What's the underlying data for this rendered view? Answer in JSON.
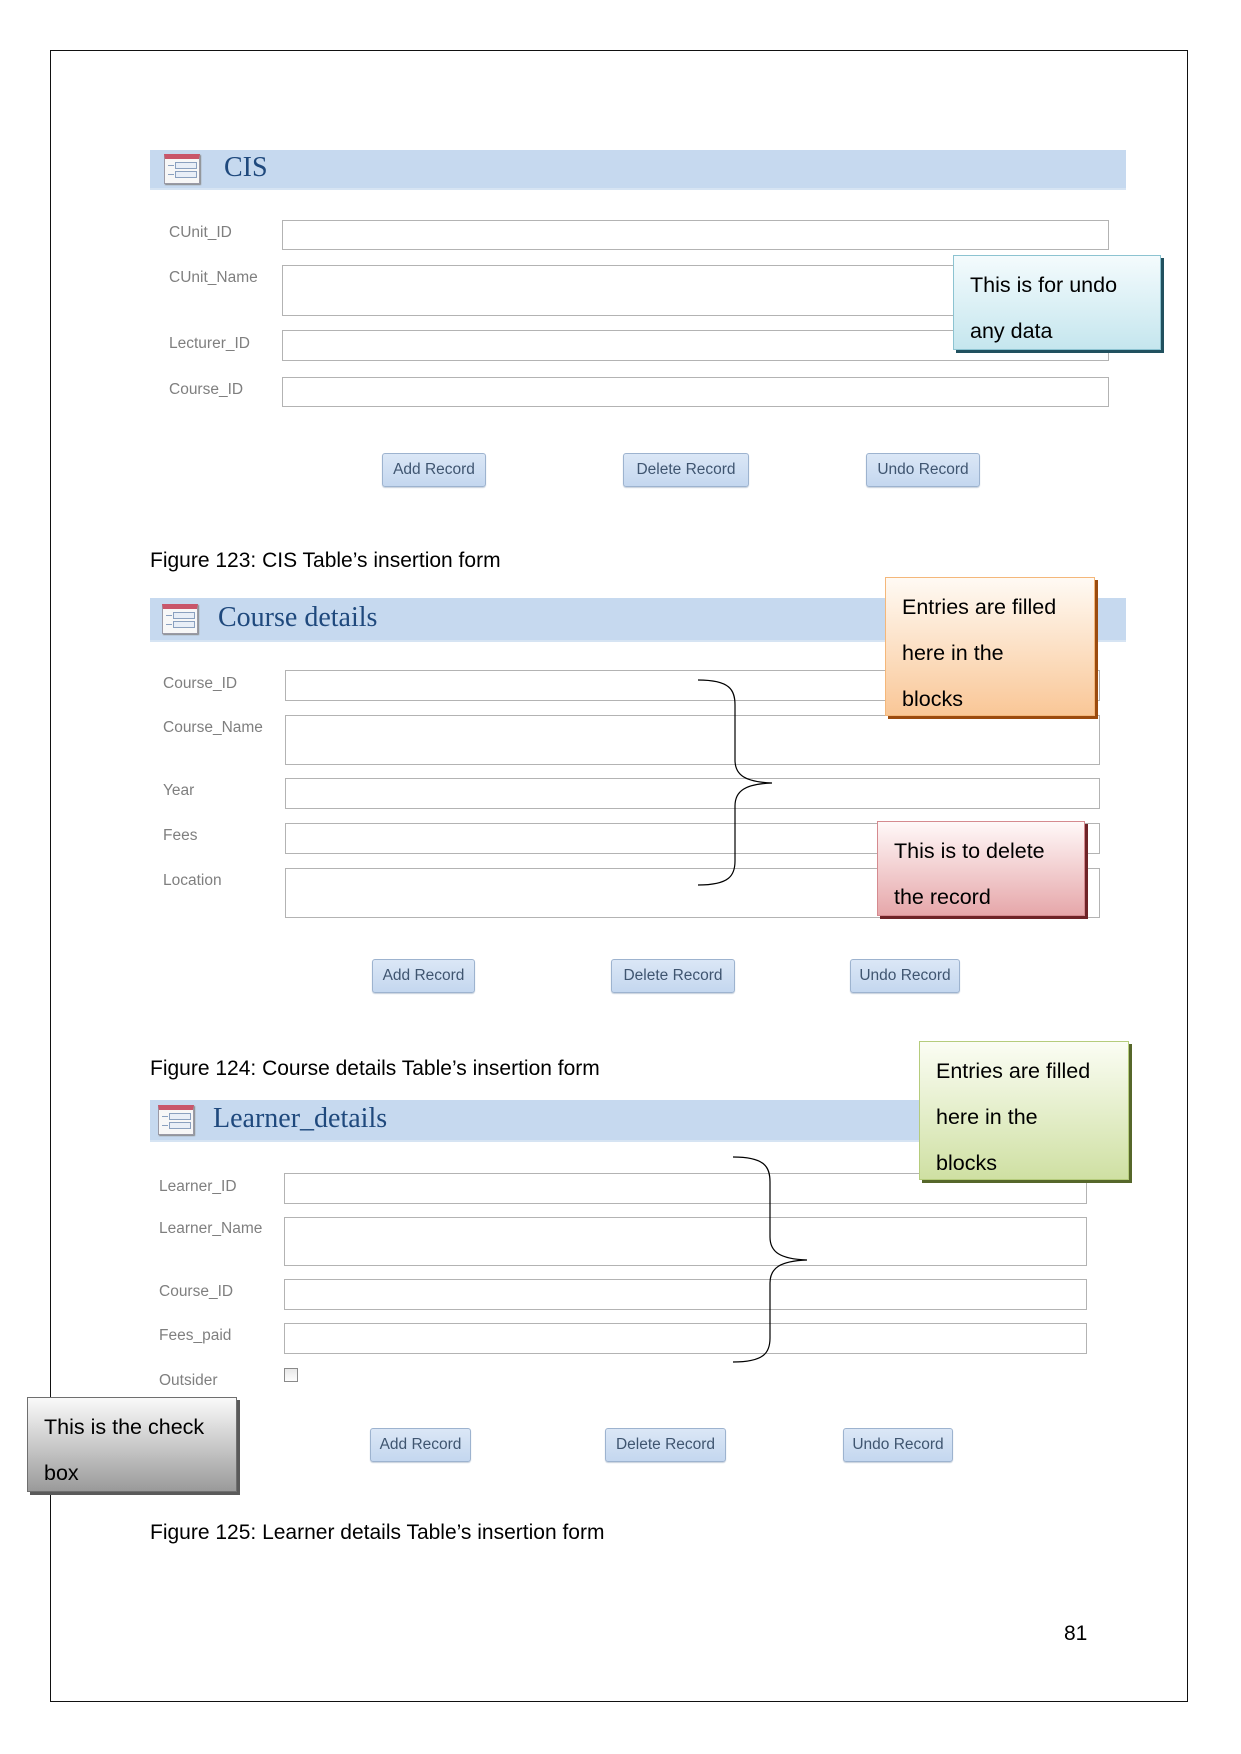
{
  "forms": [
    {
      "title": "CIS",
      "fields": [
        {
          "label": "CUnit_ID",
          "value": ""
        },
        {
          "label": "CUnit_Name",
          "value": ""
        },
        {
          "label": "Lecturer_ID",
          "value": ""
        },
        {
          "label": "Course_ID",
          "value": ""
        }
      ],
      "buttons": [
        "Add Record",
        "Delete Record",
        "Undo Record"
      ],
      "caption": "Figure 123: CIS Table’s insertion form"
    },
    {
      "title": "Course details",
      "fields": [
        {
          "label": "Course_ID",
          "value": ""
        },
        {
          "label": "Course_Name",
          "value": ""
        },
        {
          "label": "Year",
          "value": ""
        },
        {
          "label": "Fees",
          "value": ""
        },
        {
          "label": "Location",
          "value": ""
        }
      ],
      "buttons": [
        "Add Record",
        "Delete Record",
        "Undo Record"
      ],
      "caption": "Figure 124: Course details Table’s insertion form"
    },
    {
      "title": "Learner_details",
      "fields": [
        {
          "label": "Learner_ID",
          "value": ""
        },
        {
          "label": "Learner_Name",
          "value": ""
        },
        {
          "label": "Course_ID",
          "value": ""
        },
        {
          "label": "Fees_paid",
          "value": ""
        },
        {
          "label": "Outsider",
          "checked": false
        }
      ],
      "buttons": [
        "Add Record",
        "Delete Record",
        "Undo Record"
      ],
      "caption": "Figure 125: Learner details Table’s insertion form"
    }
  ],
  "callouts": {
    "undo": {
      "line1": [
        "This",
        "is",
        "for",
        "undo"
      ],
      "line2": "any data"
    },
    "entries_course": {
      "line1": [
        "Entries",
        "are",
        "filled"
      ],
      "line2": [
        "here",
        "in",
        "the"
      ],
      "line3": "blocks"
    },
    "delete": {
      "line1": [
        "This",
        "is",
        "to",
        "delete"
      ],
      "line2": "the record"
    },
    "entries_learner": {
      "line1": [
        "Entries",
        "are",
        "filled"
      ],
      "line2": [
        "here",
        "in",
        "the"
      ],
      "line3": "blocks"
    },
    "checkbox": {
      "line1": [
        "This",
        "is",
        "the",
        "check"
      ],
      "line2": "box"
    }
  },
  "page_number": "81"
}
